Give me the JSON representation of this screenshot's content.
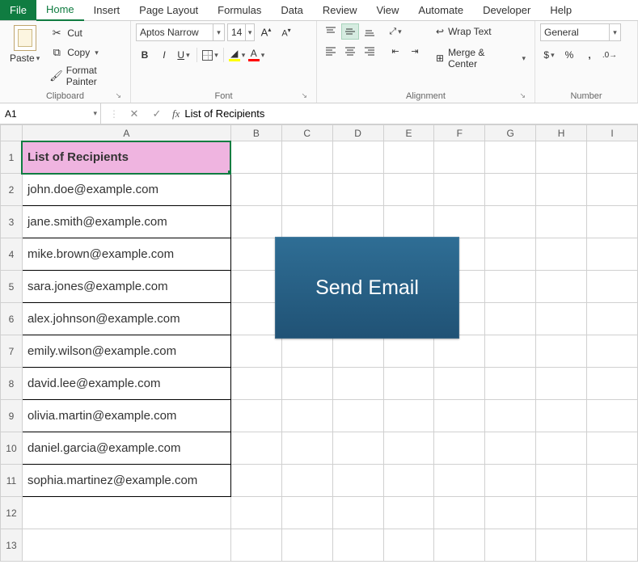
{
  "tabs": {
    "file": "File",
    "home": "Home",
    "insert": "Insert",
    "pagelayout": "Page Layout",
    "formulas": "Formulas",
    "data": "Data",
    "review": "Review",
    "view": "View",
    "automate": "Automate",
    "developer": "Developer",
    "help": "Help"
  },
  "ribbon": {
    "clipboard": {
      "label": "Clipboard",
      "paste": "Paste",
      "cut": "Cut",
      "copy": "Copy",
      "format_painter": "Format Painter"
    },
    "font": {
      "label": "Font",
      "name": "Aptos Narrow",
      "size": "14"
    },
    "alignment": {
      "label": "Alignment",
      "wrap": "Wrap Text",
      "merge": "Merge & Center"
    },
    "number": {
      "label": "Number",
      "format": "General"
    }
  },
  "namebox": "A1",
  "formula": "List of Recipients",
  "columns": [
    "A",
    "B",
    "C",
    "D",
    "E",
    "F",
    "G",
    "H",
    "I"
  ],
  "rows": [
    "1",
    "2",
    "3",
    "4",
    "5",
    "6",
    "7",
    "8",
    "9",
    "10",
    "11",
    "12",
    "13"
  ],
  "dataA": [
    "List of Recipients",
    "john.doe@example.com",
    "jane.smith@example.com",
    "mike.brown@example.com",
    "sara.jones@example.com",
    "alex.johnson@example.com",
    "emily.wilson@example.com",
    "david.lee@example.com",
    "olivia.martin@example.com",
    "daniel.garcia@example.com",
    "sophia.martinez@example.com",
    "",
    ""
  ],
  "button": {
    "label": "Send Email"
  }
}
